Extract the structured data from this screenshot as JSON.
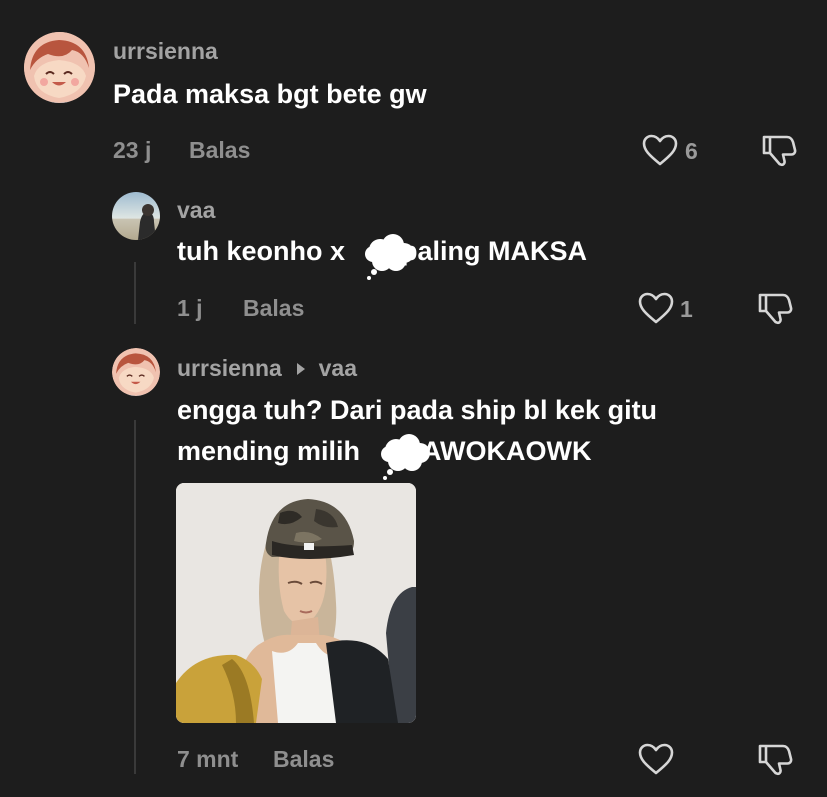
{
  "comments": [
    {
      "username": "urrsienna",
      "text": "Pada maksa bgt bete gw",
      "time": "23 j",
      "reply_label": "Balas",
      "likes": "6"
    },
    {
      "username": "vaa",
      "text_before": "tuh keonho x",
      "text_after": "paling MAKSA",
      "time": "1 j",
      "reply_label": "Balas",
      "likes": "1"
    },
    {
      "username": "urrsienna",
      "reply_to": "vaa",
      "line1": "engga tuh? Dari pada ship bl kek gitu",
      "line2_before": "mending milih",
      "line2_after": "AWOKAOWK",
      "time": "7 mnt",
      "reply_label": "Balas",
      "likes": ""
    }
  ],
  "icons": {
    "like": "heart-outline-icon",
    "dislike": "thumbs-down-icon",
    "reply_arrow": "caret-right-icon",
    "censor": "thought-cloud-sticker"
  },
  "colors": {
    "background": "#1d1d1d",
    "username": "#a3a3a3",
    "meta": "#8f8f8f",
    "text": "#ffffff"
  }
}
